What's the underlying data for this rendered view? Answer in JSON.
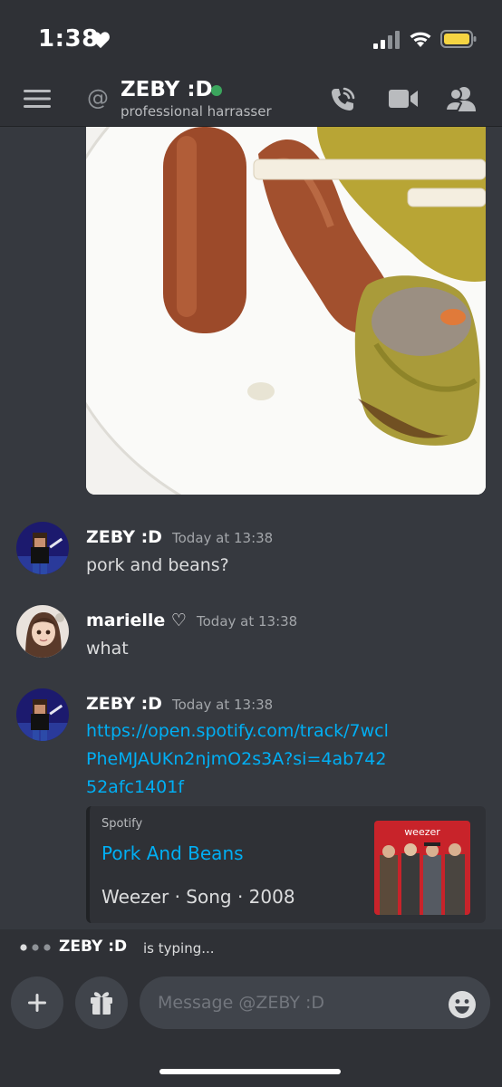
{
  "status_bar": {
    "time": "1:38",
    "icons": [
      "heart-icon",
      "signal-icon",
      "wifi-icon",
      "battery-icon"
    ]
  },
  "header": {
    "at_symbol": "@",
    "name": "ZEBY :D",
    "status": "professional harrasser",
    "online": true,
    "icons": [
      "menu-icon",
      "call-icon",
      "video-icon",
      "members-icon"
    ]
  },
  "attachment": {
    "type": "photo",
    "icon": "food-photo"
  },
  "messages": [
    {
      "author": "ZEBY :D",
      "time": "Today at 13:38",
      "text": "pork and beans?"
    },
    {
      "author": "marielle ♡",
      "time": "Today at 13:38",
      "text": "what"
    },
    {
      "author": "ZEBY :D",
      "time": "Today at 13:38",
      "link": "https://open.spotify.com/track/7wclPheMJAUKn2njmO2s3A?si=4ab74252afc1401f"
    }
  ],
  "embed": {
    "provider": "Spotify",
    "title": "Pork And Beans",
    "description": "Weezer · Song · 2008",
    "thumb_brand": "weezer"
  },
  "typing": {
    "name": "ZEBY :D",
    "text": "is typing..."
  },
  "composer": {
    "placeholder": "Message @ZEBY :D",
    "icons": [
      "plus-icon",
      "gift-icon",
      "emoji-icon"
    ]
  },
  "colors": {
    "background": "#36393f",
    "header": "#2f3136",
    "link": "#00aff4",
    "online": "#3ba55d",
    "battery": "#f5d442"
  }
}
